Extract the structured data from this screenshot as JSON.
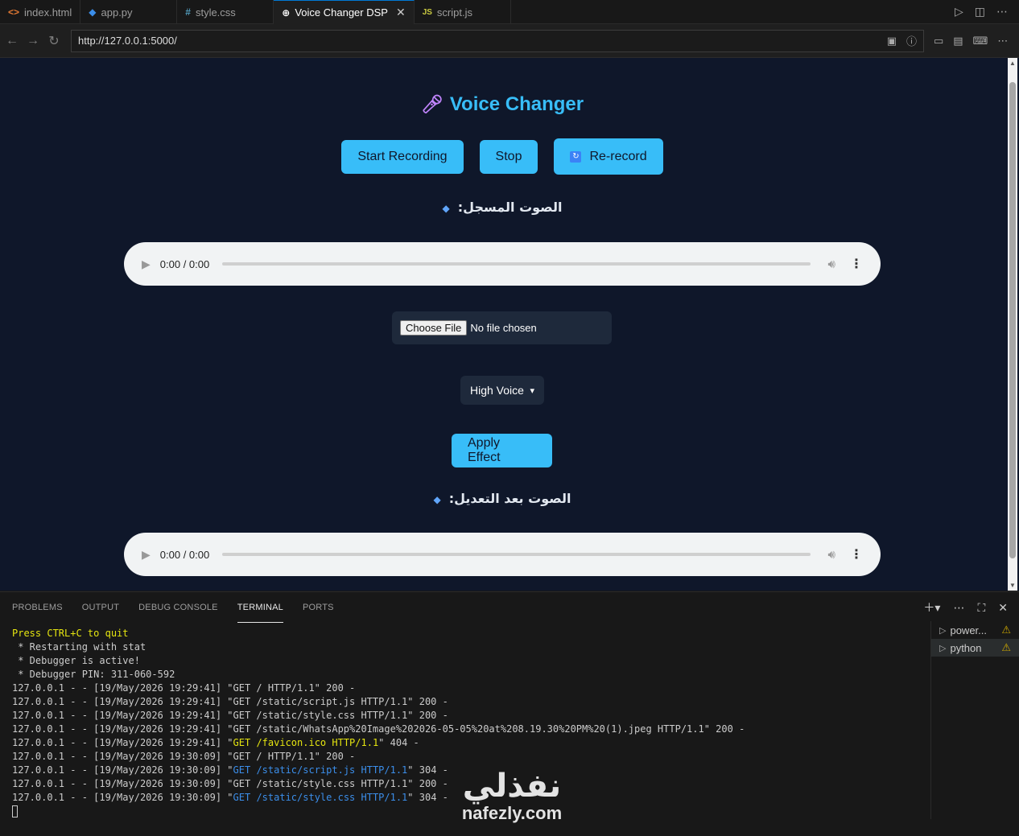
{
  "tabs": [
    {
      "label": "index.html",
      "icon": "<>",
      "icon_color": "#e37933"
    },
    {
      "label": "app.py",
      "icon": "◆",
      "icon_color": "#3b8eea"
    },
    {
      "label": "style.css",
      "icon": "#",
      "icon_color": "#519aba"
    },
    {
      "label": "Voice Changer DSP",
      "icon": "⊕",
      "icon_color": "#cccccc"
    },
    {
      "label": "script.js",
      "icon": "JS",
      "icon_color": "#cbcb41"
    }
  ],
  "browser": {
    "url": "http://127.0.0.1:5000/"
  },
  "page": {
    "title": "Voice Changer",
    "buttons": {
      "start": "Start Recording",
      "stop": "Stop",
      "rerecord": "Re-record",
      "apply": "Apply Effect"
    },
    "recorded_label": "الصوت المسجل:",
    "processed_label": "الصوت بعد التعديل:",
    "audio_time": "0:00 / 0:00",
    "file_button": "Choose File",
    "file_status": "No file chosen",
    "effect_selected": "High Voice"
  },
  "panel": {
    "tabs": [
      "PROBLEMS",
      "OUTPUT",
      "DEBUG CONSOLE",
      "TERMINAL",
      "PORTS"
    ],
    "active_tab": "TERMINAL",
    "terminals": [
      "power...",
      "python"
    ],
    "lines": [
      {
        "text": "Press CTRL+C to quit",
        "style": "yellow"
      },
      {
        "text": " * Restarting with stat"
      },
      {
        "text": " * Debugger is active!"
      },
      {
        "text": " * Debugger PIN: 311-060-592"
      },
      {
        "text": "127.0.0.1 - - [19/May/2026 19:29:41] \"GET / HTTP/1.1\" 200 -"
      },
      {
        "text": "127.0.0.1 - - [19/May/2026 19:29:41] \"GET /static/script.js HTTP/1.1\" 200 -"
      },
      {
        "text": "127.0.0.1 - - [19/May/2026 19:29:41] \"GET /static/style.css HTTP/1.1\" 200 -"
      },
      {
        "text": "127.0.0.1 - - [19/May/2026 19:29:41] \"GET /static/WhatsApp%20Image%202026-05-05%20at%208.19.30%20PM%20(1).jpeg HTTP/1.1\" 200 -"
      },
      {
        "pre": "127.0.0.1 - - [19/May/2026 19:29:41] \"",
        "hl": "GET /favicon.ico HTTP/1.1",
        "post": "\" 404 -",
        "hlstyle": "yellow"
      },
      {
        "text": "127.0.0.1 - - [19/May/2026 19:30:09] \"GET / HTTP/1.1\" 200 -"
      },
      {
        "pre": "127.0.0.1 - - [19/May/2026 19:30:09] \"",
        "hl": "GET /static/script.js HTTP/1.1",
        "post": "\" 304 -",
        "hlstyle": "blue"
      },
      {
        "text": "127.0.0.1 - - [19/May/2026 19:30:09] \"GET /static/style.css HTTP/1.1\" 200 -"
      },
      {
        "pre": "127.0.0.1 - - [19/May/2026 19:30:09] \"",
        "hl": "GET /static/style.css HTTP/1.1",
        "post": "\" 304 -",
        "hlstyle": "blue"
      }
    ]
  },
  "watermark": {
    "arabic": "نفذلي",
    "latin": "nafezly.com"
  },
  "colors": {
    "accent": "#38bdf8",
    "page_bg": "#0f172a",
    "card_bg": "#1e293b"
  }
}
